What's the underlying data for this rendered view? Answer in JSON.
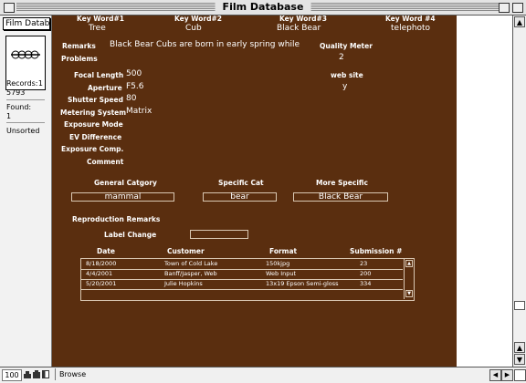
{
  "window": {
    "title": "Film Database"
  },
  "status_area": {
    "layout_name": "Film Databa",
    "page_number": "1",
    "records_label": "Records:",
    "records_value": "5793",
    "found_label": "Found:",
    "found_value": "1",
    "sort_state": "Unsorted"
  },
  "keywords": [
    {
      "label": "Key Word#1",
      "value": "Tree"
    },
    {
      "label": "Key Word#2",
      "value": "Cub"
    },
    {
      "label": "Key Word#3",
      "value": "Black Bear"
    },
    {
      "label": "Key Word #4",
      "value": "telephoto"
    }
  ],
  "remarks": {
    "label": "Remarks",
    "value": "Black Bear Cubs are born in early spring while"
  },
  "problems": {
    "label": "Problems",
    "value": ""
  },
  "quality_meter": {
    "label": "Quality Meter",
    "value": "2"
  },
  "web_site": {
    "label": "web site",
    "value": "y"
  },
  "camera": {
    "focal_length": {
      "label": "Focal Length",
      "value": "500"
    },
    "aperture": {
      "label": "Aperture",
      "value": "F5.6"
    },
    "shutter_speed": {
      "label": "Shutter Speed",
      "value": "80"
    },
    "metering_system": {
      "label": "Metering System",
      "value": "Matrix"
    },
    "exposure_mode": {
      "label": "Exposure Mode",
      "value": ""
    },
    "ev_difference": {
      "label": "EV Difference",
      "value": ""
    },
    "exposure_comp": {
      "label": "Exposure Comp.",
      "value": ""
    },
    "comment": {
      "label": "Comment",
      "value": ""
    }
  },
  "categories": {
    "general": {
      "label": "General Catgory",
      "value": "mammal"
    },
    "specific": {
      "label": "Specific Cat",
      "value": "bear"
    },
    "more_specific": {
      "label": "More Specific",
      "value": "Black Bear"
    }
  },
  "reproduction_remarks": {
    "label": "Reproduction Remarks"
  },
  "label_change": {
    "label": "Label Change",
    "value": ""
  },
  "submissions": {
    "columns": [
      "Date",
      "Customer",
      "Format",
      "Submission #"
    ],
    "rows": [
      [
        "8/18/2000",
        "Town of Cold Lake",
        "150kjpg",
        "23"
      ],
      [
        "4/4/2001",
        "Banff/Jasper, Web",
        "Web Input",
        "200"
      ],
      [
        "5/20/2001",
        "Julie Hopkins",
        "13x19 Epson Semi-gloss",
        "334"
      ]
    ]
  },
  "bottom_bar": {
    "zoom": "100",
    "mode": "Browse"
  },
  "colors": {
    "layout_background": "#5a2e0f",
    "text": "#ffffff",
    "field_border": "#d9c7b2"
  }
}
